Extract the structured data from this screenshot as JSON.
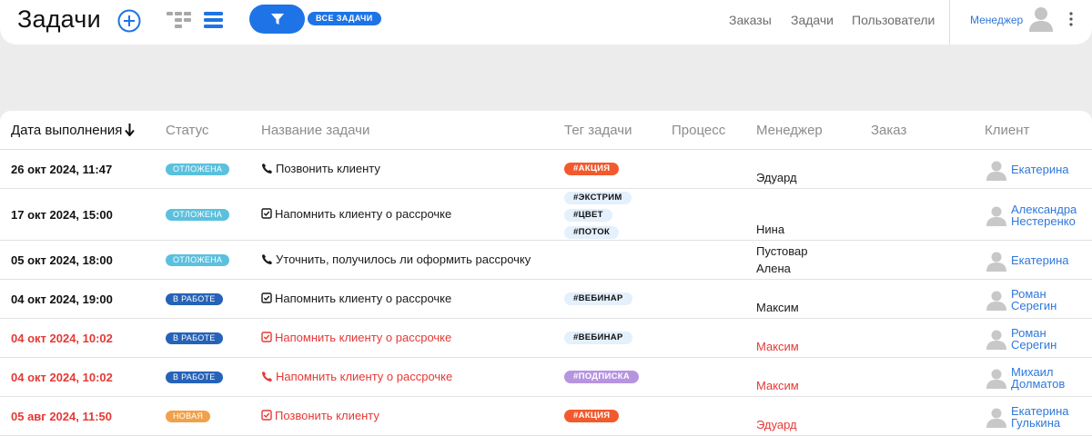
{
  "header": {
    "title": "Задачи",
    "filter_chip": "ВСЕ ЗАДАЧИ",
    "nav": [
      "Заказы",
      "Задачи",
      "Пользователи"
    ],
    "role": "Менеджер"
  },
  "columns": [
    "Дата выполнения",
    "Статус",
    "Название задачи",
    "Тег задачи",
    "Процесс",
    "Менеджер",
    "Заказ",
    "Клиент"
  ],
  "colors": {
    "accent": "#1e74e6",
    "overdue": "#e53935",
    "link": "#2f78d9",
    "status_postponed": "#5bc0de",
    "status_in_work": "#2563b8",
    "status_new": "#f0a24b"
  },
  "rows": [
    {
      "date": "26 окт 2024, 11:47",
      "overdue": false,
      "status": "ОТЛОЖЕНА",
      "status_color": "#5bc0de",
      "task_icon": "phone-icon",
      "task": "Позвонить клиенту",
      "tags": [
        {
          "text": "#АКЦИЯ",
          "kind": "action"
        }
      ],
      "manager": "Эдуард",
      "client": "Екатерина"
    },
    {
      "date": "17 окт 2024, 15:00",
      "overdue": false,
      "status": "ОТЛОЖЕНА",
      "status_color": "#5bc0de",
      "task_icon": "checkbox-icon",
      "task": "Напомнить клиенту о рассрочке",
      "tags": [
        {
          "text": "#ЭКСТРИМ",
          "kind": "plain"
        },
        {
          "text": "#ЦВЕТ",
          "kind": "plain"
        },
        {
          "text": "#ПОТОК",
          "kind": "plain"
        }
      ],
      "manager": "Нина",
      "client": "Александра Нестеренко"
    },
    {
      "date": "05 окт 2024, 18:00",
      "overdue": false,
      "status": "ОТЛОЖЕНА",
      "status_color": "#5bc0de",
      "task_icon": "phone-icon",
      "task": "Уточнить, получилось ли оформить рассрочку",
      "tags": [],
      "manager_line1": "Пустовар",
      "manager_line2": "Алена",
      "client": "Екатерина"
    },
    {
      "date": "04 окт 2024, 19:00",
      "overdue": false,
      "status": "В РАБОТЕ",
      "status_color": "#2563b8",
      "task_icon": "checkbox-icon",
      "task": "Напомнить клиенту о рассрочке",
      "tags": [
        {
          "text": "#ВЕБИНАР",
          "kind": "plain"
        }
      ],
      "manager": "Максим",
      "client": "Роман Серегин"
    },
    {
      "date": "04 окт 2024, 10:02",
      "overdue": true,
      "status": "В РАБОТЕ",
      "status_color": "#2563b8",
      "task_icon": "checkbox-icon",
      "task": "Напомнить клиенту о рассрочке",
      "tags": [
        {
          "text": "#ВЕБИНАР",
          "kind": "plain"
        }
      ],
      "manager": "Максим",
      "client": "Роман Серегин"
    },
    {
      "date": "04 окт 2024, 10:02",
      "overdue": true,
      "status": "В РАБОТЕ",
      "status_color": "#2563b8",
      "task_icon": "phone-icon",
      "task": "Напомнить клиенту о рассрочке",
      "tags": [
        {
          "text": "#ПОДПИСКА",
          "kind": "sub"
        }
      ],
      "manager": "Максим",
      "client": "Михаил Долматов"
    },
    {
      "date": "05 авг 2024, 11:50",
      "overdue": true,
      "status": "НОВАЯ",
      "status_color": "#f0a24b",
      "task_icon": "checkbox-icon",
      "task": "Позвонить клиенту",
      "tags": [
        {
          "text": "#АКЦИЯ",
          "kind": "action"
        }
      ],
      "manager": "Эдуард",
      "client": "Екатерина Гулькина"
    }
  ]
}
